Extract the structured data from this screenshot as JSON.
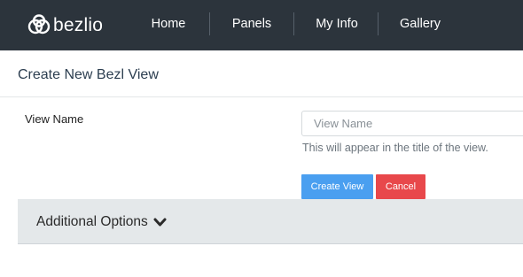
{
  "app": {
    "brand": "bezlio",
    "colors": {
      "navbar": "#2c343c",
      "primary": "#4a9ff0",
      "danger": "#e8484b",
      "options_bar": "#e4e8ea"
    }
  },
  "nav": {
    "items": [
      {
        "label": "Home"
      },
      {
        "label": "Panels"
      },
      {
        "label": "My Info"
      },
      {
        "label": "Gallery"
      }
    ]
  },
  "page": {
    "title": "Create New Bezl View"
  },
  "form": {
    "view_name": {
      "label": "View Name",
      "placeholder": "View Name",
      "value": "",
      "help": "This will appear in the title of the view."
    },
    "create_label": "Create View",
    "cancel_label": "Cancel"
  },
  "options": {
    "label": "Additional Options",
    "icon": "chevron-down-icon"
  }
}
